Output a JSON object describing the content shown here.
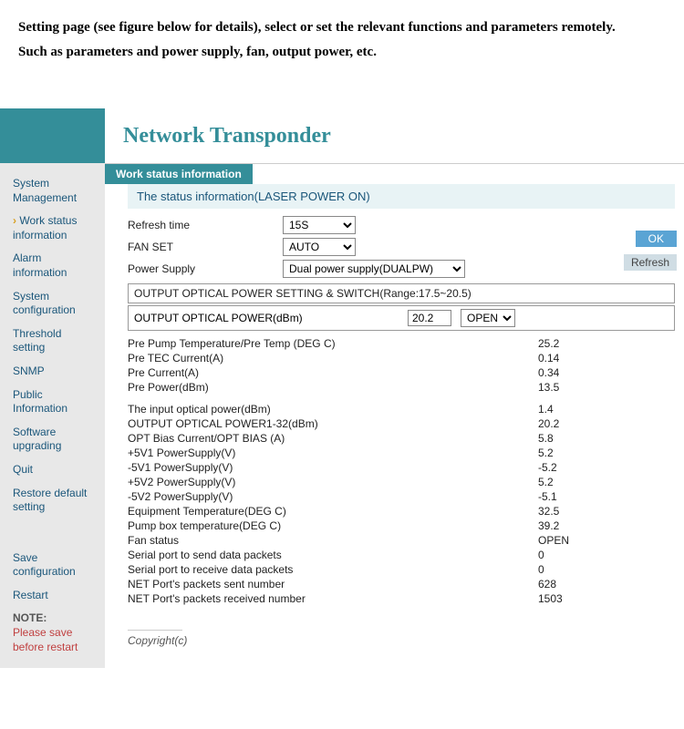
{
  "intro": {
    "line1": "Setting page (see figure below for details), select or set the relevant functions and parameters remotely.",
    "line2": "Such as parameters and power supply, fan, output power, etc."
  },
  "header": {
    "title": "Network Transponder"
  },
  "tab": {
    "label": "Work status information"
  },
  "sidebar": {
    "items": [
      {
        "label": "System Management",
        "active": false
      },
      {
        "label": "Work status information",
        "active": true
      },
      {
        "label": "Alarm information",
        "active": false
      },
      {
        "label": "System configuration",
        "active": false
      },
      {
        "label": "Threshold setting",
        "active": false
      },
      {
        "label": "SNMP",
        "active": false
      },
      {
        "label": "Public Information",
        "active": false
      },
      {
        "label": "Software upgrading",
        "active": false
      },
      {
        "label": "Quit",
        "active": false
      },
      {
        "label": "Restore default setting",
        "active": false
      }
    ],
    "lower": [
      {
        "label": "Save configuration"
      },
      {
        "label": "Restart"
      }
    ],
    "note_label": "NOTE:",
    "note_text": "Please save before restart"
  },
  "status": {
    "title": "The status information(LASER POWER ON)",
    "refresh_label": "Refresh time",
    "refresh_value": "15S",
    "fan_label": "FAN SET",
    "fan_value": "AUTO",
    "power_label": "Power Supply",
    "power_value": "Dual power supply(DUALPW)",
    "section_header": "OUTPUT OPTICAL POWER SETTING & SWITCH(Range:17.5~20.5)",
    "output_power_label": "OUTPUT OPTICAL POWER(dBm)",
    "output_power_value": "20.2",
    "output_power_switch": "OPEN"
  },
  "metrics_a": [
    {
      "label": "Pre Pump Temperature/Pre Temp (DEG C)",
      "value": "25.2"
    },
    {
      "label": "Pre TEC Current(A)",
      "value": "0.14"
    },
    {
      "label": "Pre Current(A)",
      "value": "0.34"
    },
    {
      "label": "Pre Power(dBm)",
      "value": "13.5"
    }
  ],
  "metrics_b": [
    {
      "label": "The input optical power(dBm)",
      "value": "1.4"
    },
    {
      "label": "OUTPUT OPTICAL POWER1-32(dBm)",
      "value": "20.2"
    },
    {
      "label": "OPT Bias Current/OPT BIAS (A)",
      "value": "5.8"
    },
    {
      "label": "+5V1 PowerSupply(V)",
      "value": "5.2"
    },
    {
      "label": "-5V1 PowerSupply(V)",
      "value": "-5.2"
    },
    {
      "label": "+5V2 PowerSupply(V)",
      "value": "5.2"
    },
    {
      "label": "-5V2 PowerSupply(V)",
      "value": "-5.1"
    },
    {
      "label": "Equipment Temperature(DEG C)",
      "value": "32.5"
    },
    {
      "label": "Pump box temperature(DEG C)",
      "value": "39.2"
    },
    {
      "label": "Fan status",
      "value": "OPEN"
    },
    {
      "label": "Serial port to send data packets",
      "value": "0"
    },
    {
      "label": "Serial port to receive data packets",
      "value": "0"
    },
    {
      "label": "NET Port's packets sent number",
      "value": "628"
    },
    {
      "label": "NET Port's packets received number",
      "value": "1503"
    }
  ],
  "buttons": {
    "ok": "OK",
    "refresh": "Refresh"
  },
  "footer": {
    "copyright": "Copyright(c)"
  }
}
